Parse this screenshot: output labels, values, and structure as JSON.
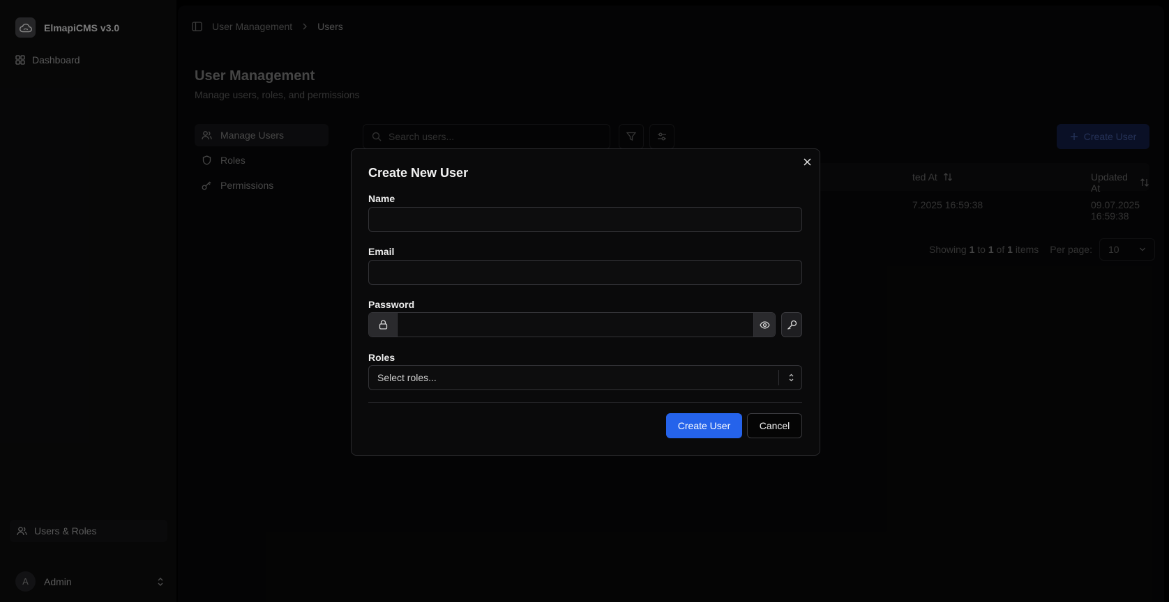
{
  "app": {
    "name": "ElmapiCMS v3.0"
  },
  "sidebar": {
    "dashboard_label": "Dashboard",
    "users_roles_label": "Users & Roles",
    "account": {
      "initial": "A",
      "name": "Admin"
    }
  },
  "breadcrumb": [
    "User Management",
    "Users"
  ],
  "page": {
    "title": "User Management",
    "subtitle": "Manage users, roles, and permissions"
  },
  "subnav": [
    {
      "label": "Manage Users",
      "icon": "users-icon",
      "active": true
    },
    {
      "label": "Roles",
      "icon": "shield-icon",
      "active": false
    },
    {
      "label": "Permissions",
      "icon": "key-icon",
      "active": false
    }
  ],
  "toolbar": {
    "search_placeholder": "Search users...",
    "create_label": "Create User"
  },
  "table": {
    "columns": [
      "ted At",
      "Updated At"
    ],
    "rows": [
      [
        "7.2025 16:59:38",
        "09.07.2025 16:59:38"
      ]
    ]
  },
  "pagination": {
    "showing_prefix": "Showing",
    "from": "1",
    "to_word": "to",
    "to": "1",
    "of_word": "of",
    "total": "1",
    "items_word": "items",
    "per_page_label": "Per page:",
    "per_page_value": "10"
  },
  "modal": {
    "title": "Create New User",
    "fields": {
      "name_label": "Name",
      "name_value": "",
      "email_label": "Email",
      "email_value": "",
      "password_label": "Password",
      "password_value": "",
      "roles_label": "Roles",
      "roles_placeholder": "Select roles..."
    },
    "submit_label": "Create User",
    "cancel_label": "Cancel"
  },
  "colors": {
    "primary": "#2563eb",
    "background": "#000000",
    "modal_bg": "#0a0a0b"
  }
}
